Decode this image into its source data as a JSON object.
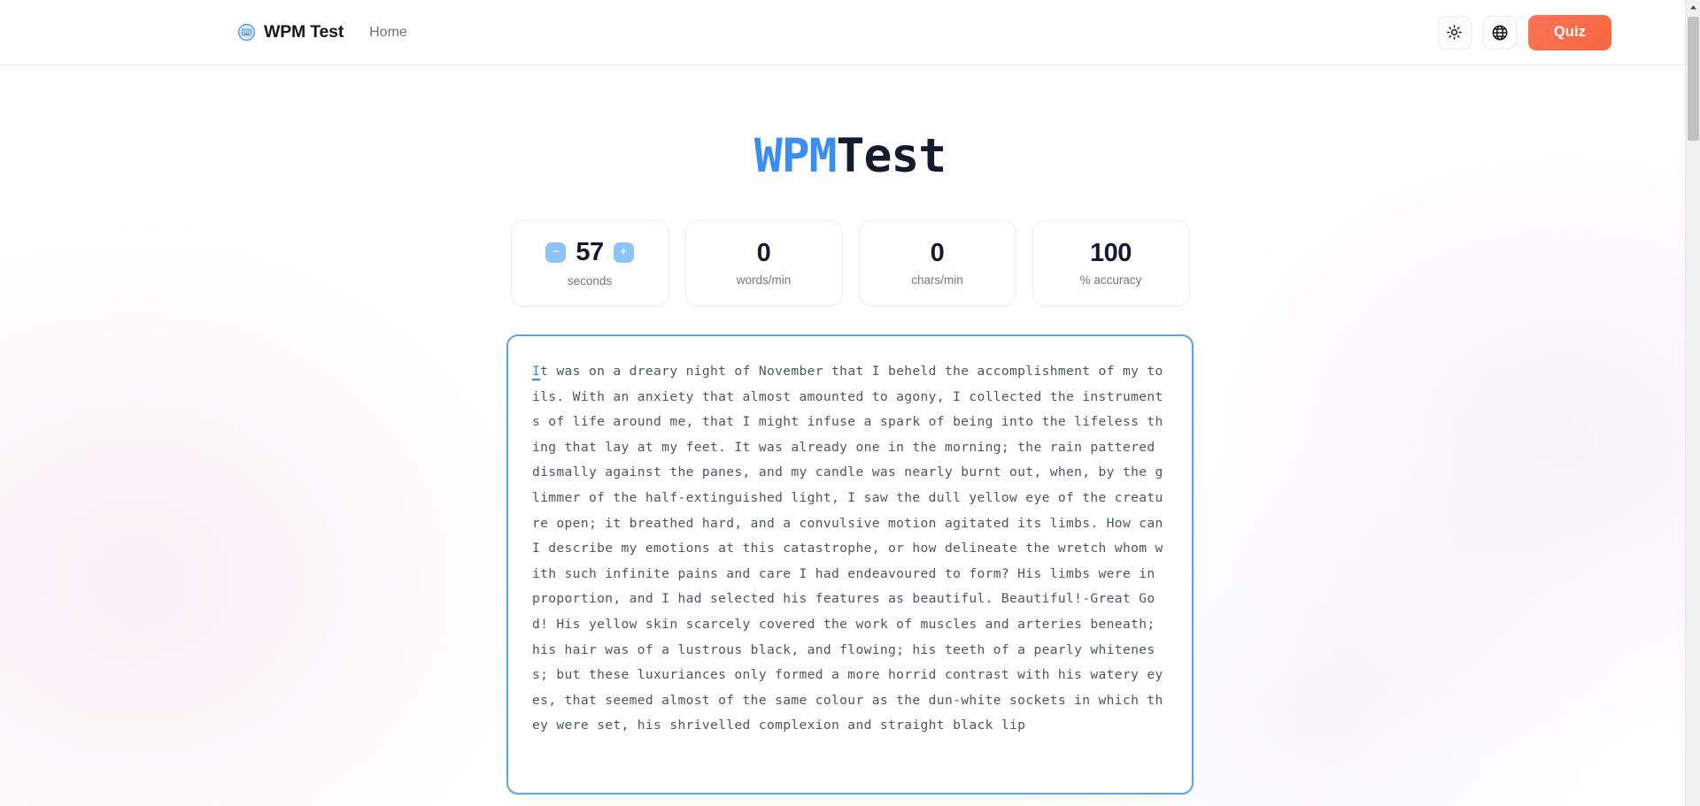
{
  "header": {
    "logo_icon": "keyboard-circle-icon",
    "brand_name": "WPM Test",
    "nav": [
      {
        "label": "Home"
      }
    ],
    "theme_toggle_icon": "sun-icon",
    "language_icon": "globe-icon",
    "quiz_label": "Quiz"
  },
  "title": {
    "part_accent": "WPM",
    "part_dark": "Test",
    "accent_color": "#3b8ef0",
    "dark_color": "#141b2e"
  },
  "stats": {
    "seconds": {
      "value": "57",
      "label": "seconds",
      "decrement_label": "−",
      "increment_label": "+",
      "button_color": "#8cc5f5"
    },
    "cards": [
      {
        "value": "0",
        "label": "words/min"
      },
      {
        "value": "0",
        "label": "chars/min"
      },
      {
        "value": "100",
        "label": "% accuracy"
      }
    ]
  },
  "typing": {
    "border_color": "#5ba4e8",
    "caret_char": "I",
    "caret_color": "#3b82f6",
    "text_remaining": "t was on a dreary night of November that I beheld the accomplishment of my toils. With an anxiety that almost amounted to agony, I collected the instruments of life around me, that I might infuse a spark of being into the lifeless thing that lay at my feet. It was already one in the morning; the rain pattered dismally against the panes, and my candle was nearly burnt out, when, by the glimmer of the half-extinguished light, I saw the dull yellow eye of the creature open; it breathed hard, and a convulsive motion agitated its limbs. How can I describe my emotions at this catastrophe, or how delineate the wretch whom with such infinite pains and care I had endeavoured to form? His limbs were in proportion, and I had selected his features as beautiful. Beautiful!-Great God! His yellow skin scarcely covered the work of muscles and arteries beneath; his hair was of a lustrous black, and flowing; his teeth of a pearly whiteness; but these luxuriances only formed a more horrid contrast with his watery eyes, that seemed almost of the same colour as the dun-white sockets in which they were set, his shrivelled complexion and straight black lip"
  },
  "scrollbar": {
    "up_arrow_icon": "caret-up-icon"
  }
}
